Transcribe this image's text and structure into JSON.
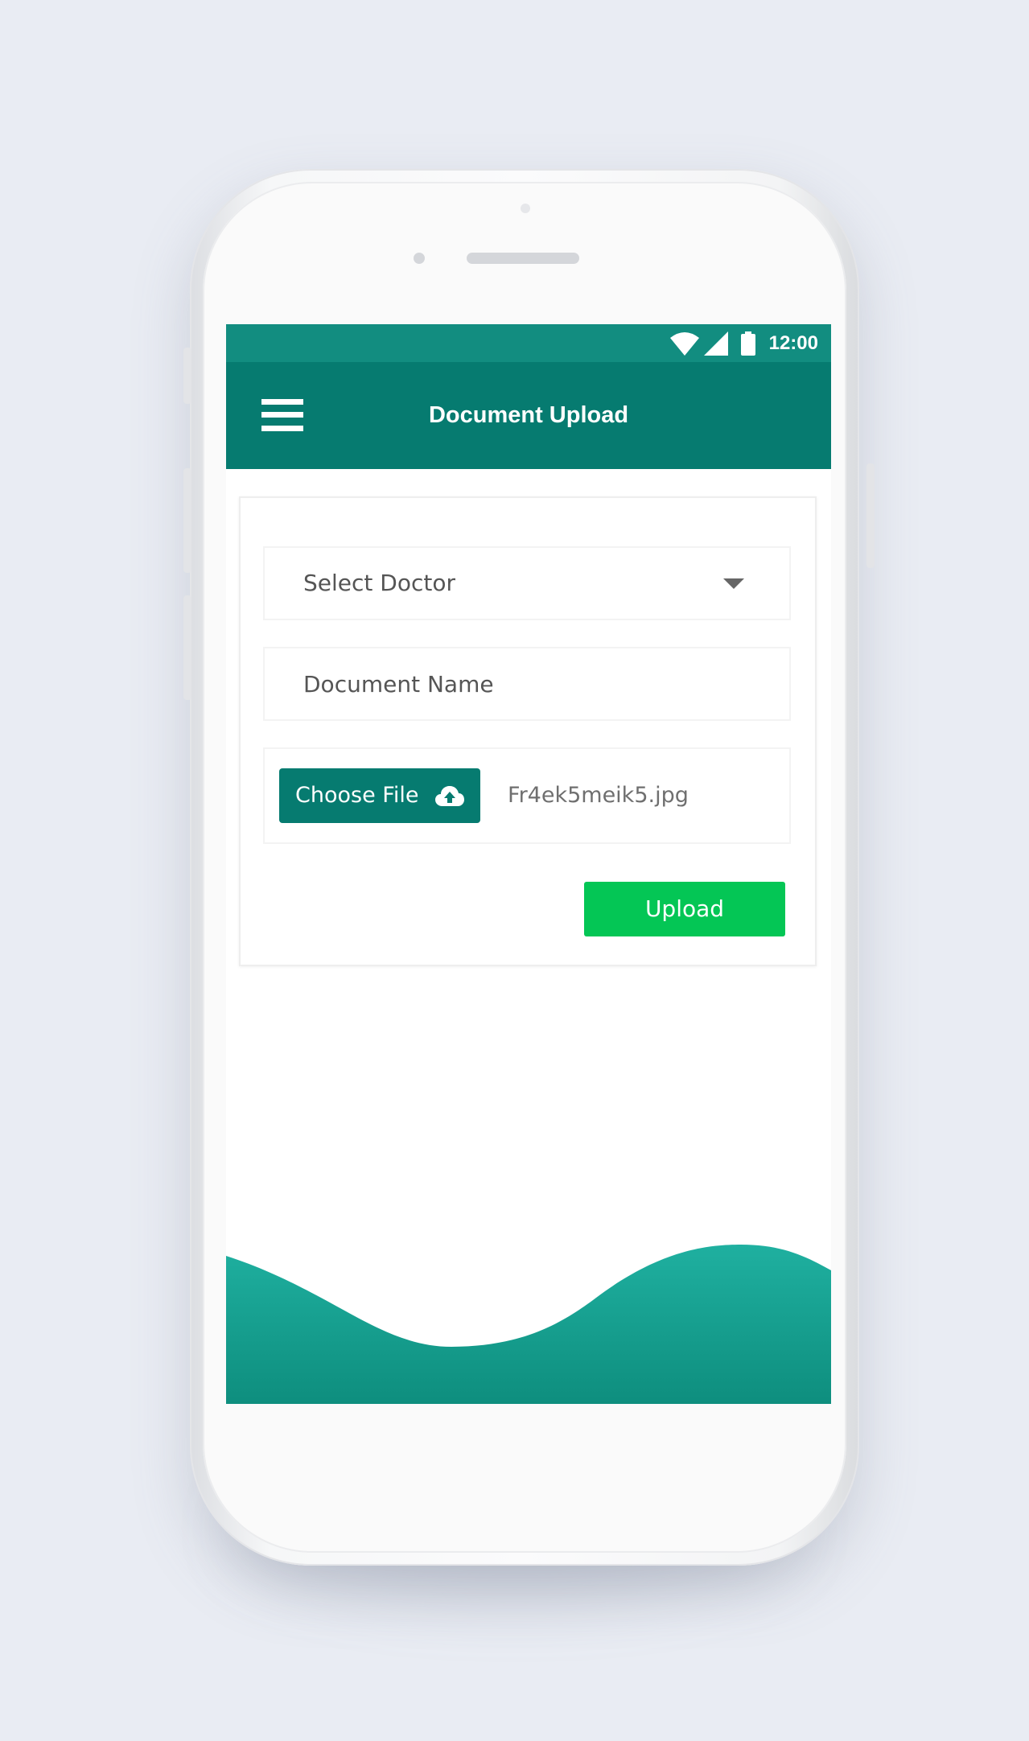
{
  "status_bar": {
    "time": "12:00",
    "icons": [
      "wifi-icon",
      "cellular-signal-icon",
      "battery-icon"
    ],
    "background": "#128d80"
  },
  "app_bar": {
    "title": "Document Upload",
    "menu_icon": "hamburger-menu-icon",
    "background": "#067b70"
  },
  "form": {
    "doctor_select": {
      "value": "Select Doctor",
      "icon": "dropdown-arrow-icon"
    },
    "document_name": {
      "placeholder": "Document Name",
      "value": ""
    },
    "file": {
      "choose_label": "Choose File",
      "choose_icon": "cloud-upload-icon",
      "selected_file": "Fr4ek5meik5.jpg"
    },
    "upload_label": "Upload",
    "upload_color": "#04c655"
  },
  "colors": {
    "primary": "#067b70",
    "wave_top": "#1fb0a0",
    "wave_bottom": "#0e8e7e",
    "page_background": "#e9ecf3"
  }
}
